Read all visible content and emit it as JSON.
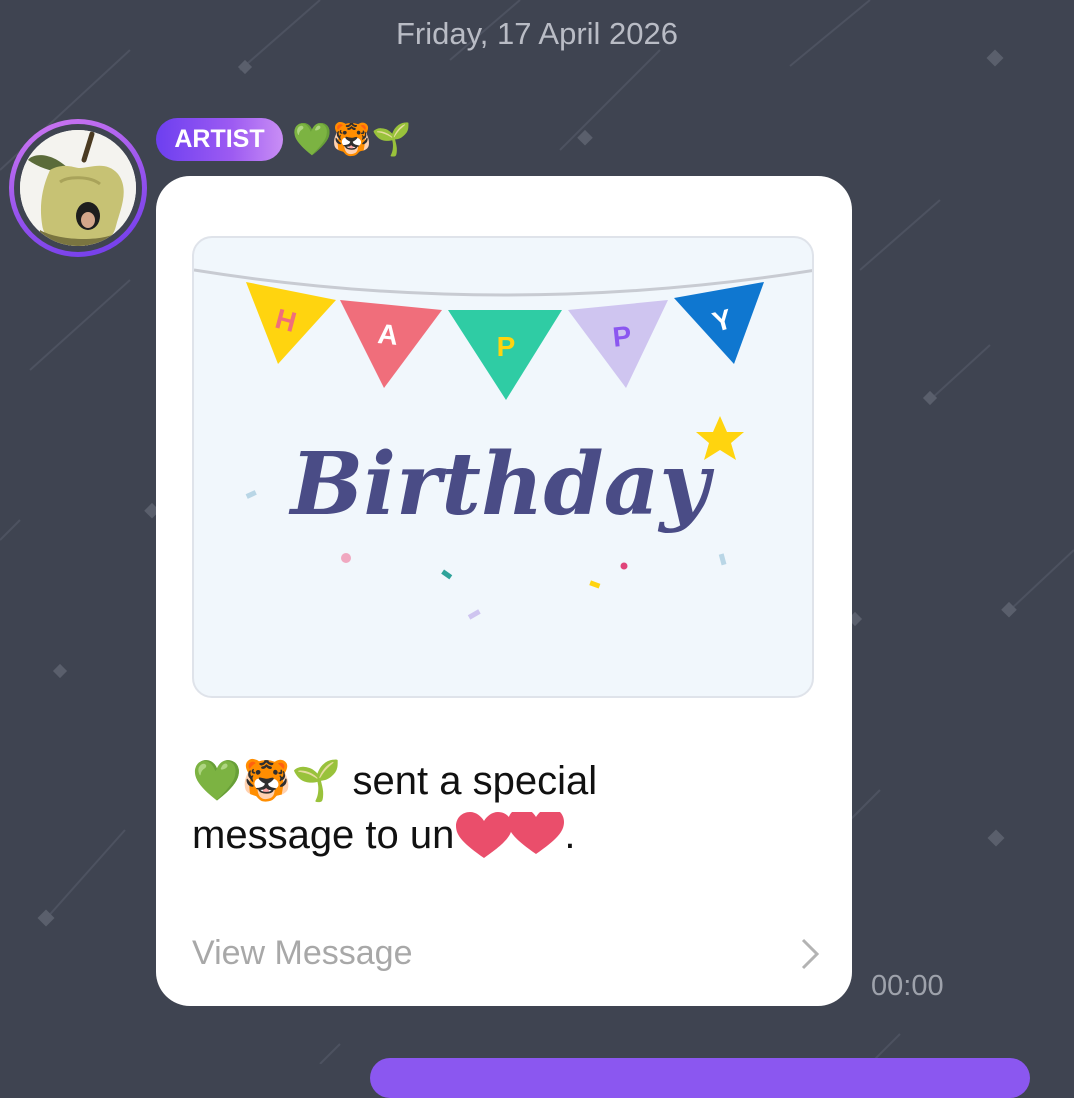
{
  "date_header": "Friday, 17 April 2026",
  "sender": {
    "badge": "ARTIST",
    "name": "💚🐯🌱"
  },
  "message": {
    "image_banner_letters": [
      "H",
      "A",
      "P",
      "P",
      "Y"
    ],
    "image_title": "Birthday",
    "text": "💚🐯🌱 sent a special message to un",
    "text_end": ".",
    "action_label": "View Message",
    "timestamp": "00:00"
  },
  "colors": {
    "background": "#3f4451",
    "accent": "#8b57f0",
    "badge_gradient_start": "#6d3ff0",
    "badge_gradient_end": "#c98ef5",
    "card": "#ffffff"
  }
}
